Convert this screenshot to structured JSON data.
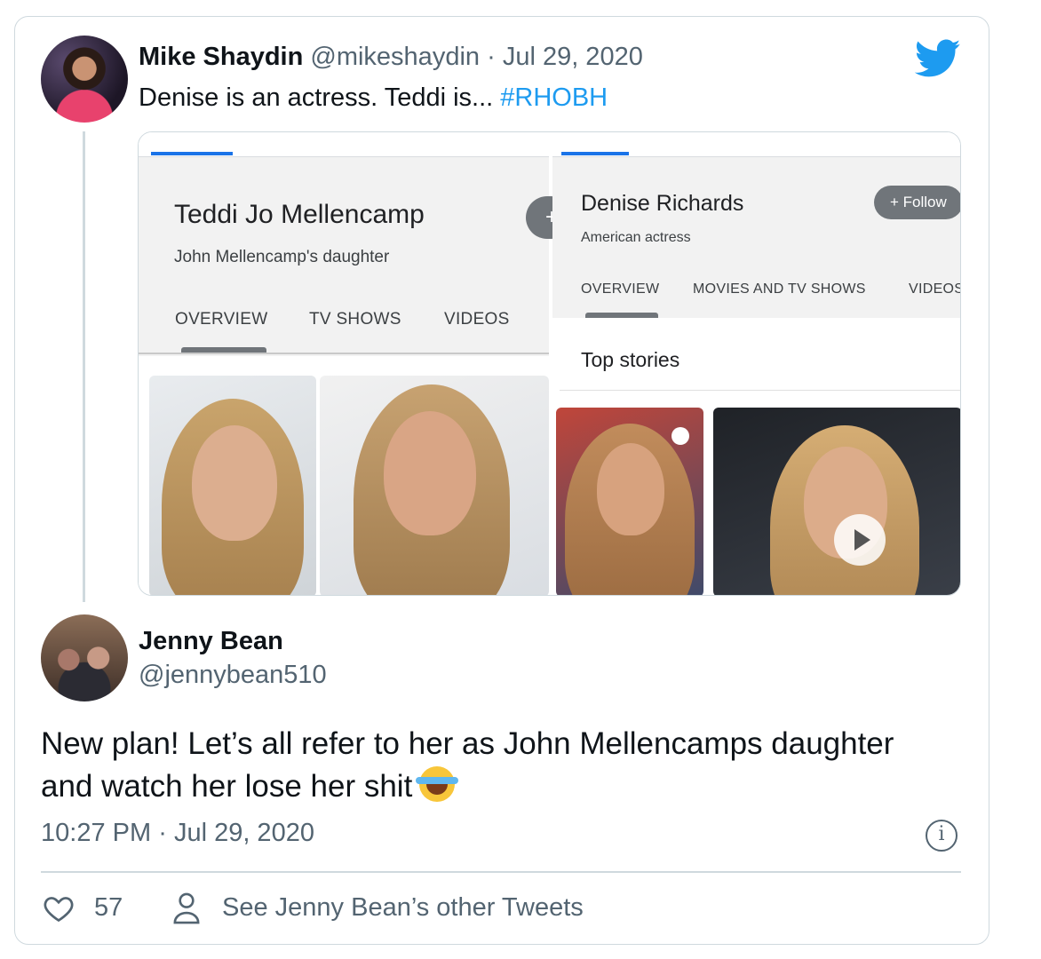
{
  "quoted_tweet": {
    "name": "Mike Shaydin",
    "handle": "@mikeshaydin",
    "separator": "·",
    "date": "Jul 29, 2020",
    "text": "Denise is an actress. Teddi is... ",
    "hashtag": "#RHOBH",
    "media": {
      "left_panel": {
        "title": "Teddi Jo Mellencamp",
        "subtitle": "John Mellencamp's daughter",
        "follow_glyph": "+",
        "tabs": [
          "OVERVIEW",
          "TV SHOWS",
          "VIDEOS"
        ]
      },
      "right_panel": {
        "title": "Denise Richards",
        "subtitle": "American actress",
        "follow_label": "+ Follow",
        "tabs": [
          "OVERVIEW",
          "MOVIES AND TV SHOWS",
          "VIDEOS"
        ],
        "section": "Top stories"
      }
    }
  },
  "tweet": {
    "name": "Jenny Bean",
    "handle": "@jennybean510",
    "text": "New plan!  Let’s all refer to her as John Mellencamps daughter and watch her lose her shit",
    "emoji": "face-with-tears-of-joy",
    "time": "10:27 PM",
    "separator": "·",
    "date": "Jul 29, 2020",
    "likes": "57",
    "see_other": "See Jenny Bean’s other Tweets",
    "info_glyph": "i"
  },
  "colors": {
    "link": "#1d9bf0",
    "secondary_text": "#536471",
    "border": "#cfd9de"
  },
  "icons": [
    "twitter-bird-icon",
    "info-icon",
    "heart-icon",
    "person-icon",
    "play-icon"
  ]
}
